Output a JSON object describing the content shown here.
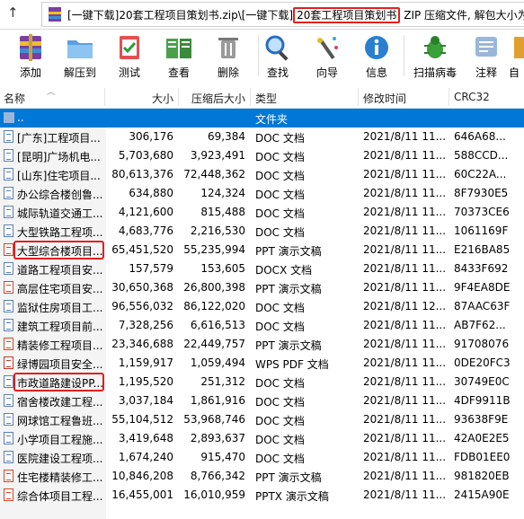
{
  "address": {
    "path_prefix": "[一键下载]20套工程项目策划书.zip\\[一键下载]",
    "path_highlight": "20套工程项目策划书",
    "path_suffix": "ZIP 压缩文件, 解包大小为"
  },
  "toolbar": {
    "add": "添加",
    "extract": "解压到",
    "test": "测试",
    "view": "查看",
    "delete": "删除",
    "find": "查找",
    "wizard": "向导",
    "info": "信息",
    "scan": "扫描病毒",
    "comment": "注释",
    "more": "自"
  },
  "columns": {
    "name": "名称",
    "size": "大小",
    "packed": "压缩后大小",
    "type": "类型",
    "modified": "修改时间",
    "crc": "CRC32"
  },
  "parent": {
    "name": "..",
    "type": "文件夹"
  },
  "files": [
    {
      "name": "[广东]工程项目...",
      "size": "306,176",
      "packed": "69,384",
      "type": "DOC 文档",
      "date": "2021/8/11 11...",
      "crc": "646A68...",
      "icon": "doc"
    },
    {
      "name": "[昆明]广场机电...",
      "size": "5,703,680",
      "packed": "3,923,491",
      "type": "DOC 文档",
      "date": "2021/8/11 11...",
      "crc": "588CCD...",
      "icon": "doc"
    },
    {
      "name": "[山东]住宅项目...",
      "size": "80,613,376",
      "packed": "72,448,362",
      "type": "DOC 文档",
      "date": "2021/8/11 11...",
      "crc": "60C22A...",
      "icon": "doc"
    },
    {
      "name": "办公综合楼创鲁...",
      "size": "634,880",
      "packed": "124,324",
      "type": "DOC 文档",
      "date": "2021/8/11 11...",
      "crc": "8F7930E5",
      "icon": "doc"
    },
    {
      "name": "城际轨道交通工...",
      "size": "4,121,600",
      "packed": "815,488",
      "type": "DOC 文档",
      "date": "2021/8/11 11...",
      "crc": "70373CE6",
      "icon": "doc"
    },
    {
      "name": "大型铁路工程项...",
      "size": "4,683,776",
      "packed": "2,216,530",
      "type": "DOC 文档",
      "date": "2021/8/11 11...",
      "crc": "1061169F",
      "icon": "doc"
    },
    {
      "name": "大型综合楼项目...",
      "size": "65,451,520",
      "packed": "55,235,994",
      "type": "PPT 演示文稿",
      "date": "2021/8/11 11...",
      "crc": "E216BA85",
      "icon": "ppt"
    },
    {
      "name": "道路工程项目安...",
      "size": "157,579",
      "packed": "153,605",
      "type": "DOCX 文档",
      "date": "2021/8/11 11...",
      "crc": "8433F692",
      "icon": "doc"
    },
    {
      "name": "高层住宅项目安...",
      "size": "30,650,368",
      "packed": "26,800,398",
      "type": "PPT 演示文稿",
      "date": "2021/8/11 11...",
      "crc": "9F4EA8DE",
      "icon": "ppt"
    },
    {
      "name": "监狱住房项目工...",
      "size": "96,556,032",
      "packed": "86,122,020",
      "type": "DOC 文档",
      "date": "2021/8/11 12...",
      "crc": "87AAC63F",
      "icon": "doc"
    },
    {
      "name": "建筑工程项目前...",
      "size": "7,328,256",
      "packed": "6,616,513",
      "type": "DOC 文档",
      "date": "2021/8/11 11...",
      "crc": "AB7F62...",
      "icon": "doc"
    },
    {
      "name": "精装修工程项目...",
      "size": "23,346,688",
      "packed": "22,449,757",
      "type": "PPT 演示文稿",
      "date": "2021/8/11 11...",
      "crc": "91708076",
      "icon": "ppt"
    },
    {
      "name": "绿博园项目安全...",
      "size": "1,159,917",
      "packed": "1,059,494",
      "type": "WPS PDF 文档",
      "date": "2021/8/11 11...",
      "crc": "0DE20FC3",
      "icon": "pdf"
    },
    {
      "name": "市政道路建设PP...",
      "size": "1,195,520",
      "packed": "251,312",
      "type": "DOC 文档",
      "date": "2021/8/11 11...",
      "crc": "30749E0C",
      "icon": "doc"
    },
    {
      "name": "宿舍楼改建工程...",
      "size": "3,037,184",
      "packed": "1,861,916",
      "type": "DOC 文档",
      "date": "2021/8/11 11...",
      "crc": "4DF9911B",
      "icon": "doc"
    },
    {
      "name": "网球馆工程鲁班...",
      "size": "55,104,512",
      "packed": "53,968,746",
      "type": "DOC 文档",
      "date": "2021/8/11 11...",
      "crc": "93638F9E",
      "icon": "doc"
    },
    {
      "name": "小学项目工程施...",
      "size": "3,419,648",
      "packed": "2,893,637",
      "type": "DOC 文档",
      "date": "2021/8/11 11...",
      "crc": "42A0E2E5",
      "icon": "doc"
    },
    {
      "name": "医院建设工程项...",
      "size": "1,674,240",
      "packed": "915,470",
      "type": "DOC 文档",
      "date": "2021/8/11 11...",
      "crc": "FDB01EE0",
      "icon": "doc"
    },
    {
      "name": "住宅楼精装修工...",
      "size": "10,846,208",
      "packed": "8,766,342",
      "type": "PPT 演示文稿",
      "date": "2021/8/11 11...",
      "crc": "981820EB",
      "icon": "ppt"
    },
    {
      "name": "综合体项目工程...",
      "size": "16,455,001",
      "packed": "16,010,959",
      "type": "PPTX 演示文稿",
      "date": "2021/8/11 11...",
      "crc": "2415A90E",
      "icon": "ppt"
    }
  ],
  "colors": {
    "selection": "#0078d7",
    "highlight_box": "#e02020"
  }
}
